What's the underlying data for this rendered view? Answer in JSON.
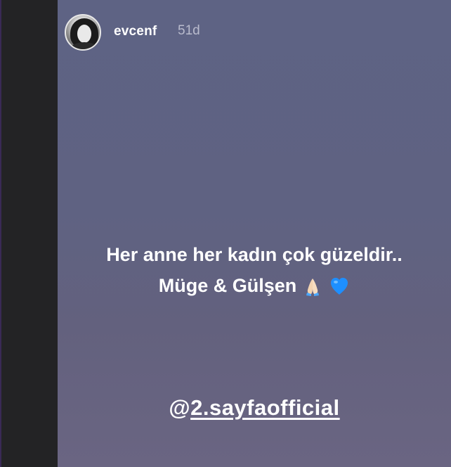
{
  "story": {
    "username": "evcenf",
    "time_ago": "51d",
    "caption_line1": "Her anne her kadın çok güzeldir..",
    "caption_line2": "Müge & Gülşen",
    "caption_emojis": [
      "folded-hands-icon",
      "blue-heart-icon"
    ],
    "mention_prefix": "@",
    "mention_handle": "2.sayfaofficial"
  },
  "colors": {
    "background_top": "#5e6384",
    "background_bottom": "#6a6582",
    "text": "#ffffff",
    "time_text": "#b9bbcd",
    "heart": "#1e8fff"
  }
}
